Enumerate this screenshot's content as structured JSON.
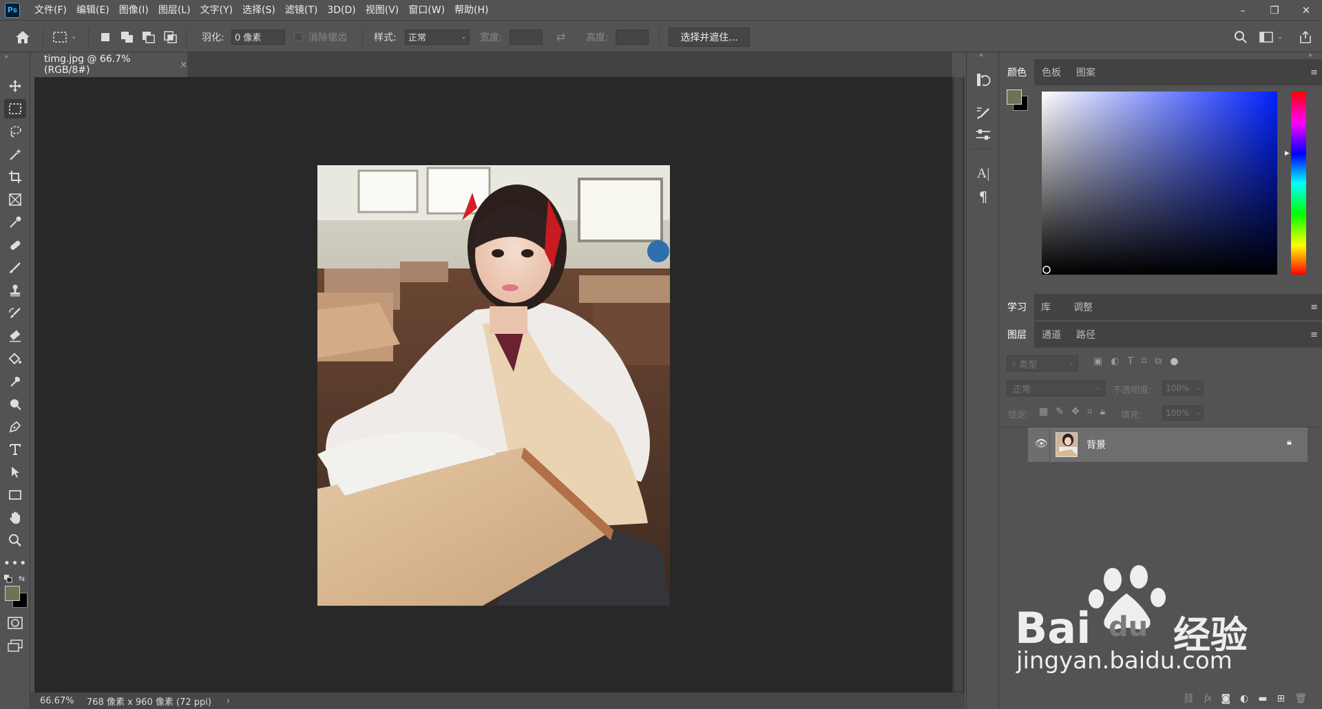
{
  "app": {
    "logo": "Ps"
  },
  "menu": [
    "文件(F)",
    "编辑(E)",
    "图像(I)",
    "图层(L)",
    "文字(Y)",
    "选择(S)",
    "滤镜(T)",
    "3D(D)",
    "视图(V)",
    "窗口(W)",
    "帮助(H)"
  ],
  "window_controls": {
    "minimize": "–",
    "restore": "❐",
    "close": "✕"
  },
  "options": {
    "feather_label": "羽化:",
    "feather_value": "0 像素",
    "antialias_label": "消除锯齿",
    "style_label": "样式:",
    "style_value": "正常",
    "width_label": "宽度:",
    "height_label": "高度:",
    "select_mask_button": "选择并遮住..."
  },
  "document": {
    "tab_title": "timg.jpg @ 66.7%(RGB/8#)",
    "close": "×",
    "zoom": "66.67%",
    "info": "768 像素 x 960 像素 (72 ppi)",
    "arrow": "›"
  },
  "panels": {
    "color_tabs": [
      "颜色",
      "色板",
      "图案"
    ],
    "learn_tabs": [
      "学习",
      "库",
      "调整"
    ],
    "layer_tabs": [
      "图层",
      "通道",
      "路径"
    ],
    "filter_kind": "类型",
    "blend_mode": "正常",
    "opacity_label": "不透明度:",
    "opacity_value": "100%",
    "lock_label": "锁定:",
    "fill_label": "填充:",
    "fill_value": "100%",
    "layer_name": "背景"
  },
  "colors": {
    "foreground": "#6e7356",
    "background": "#000000",
    "picker_hue": "#0022ff"
  },
  "watermark": {
    "brand_left": "Bai",
    "brand_du": "du",
    "brand_cn": "经验",
    "url": "jingyan.baidu.com"
  }
}
